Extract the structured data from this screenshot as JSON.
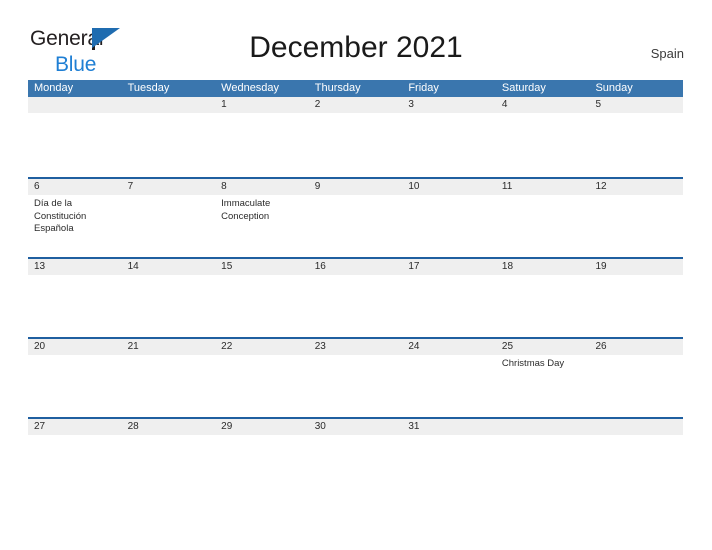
{
  "brand": {
    "name_part1": "General",
    "name_part2": "Blue",
    "logo_icon": "triangle-flag-icon",
    "color_dark": "#231f20",
    "color_blue": "#1f7fd4"
  },
  "header": {
    "title": "December 2021",
    "country": "Spain"
  },
  "theme": {
    "header_bar": "#3a76ae",
    "week_rule": "#1f5fa0",
    "day_band": "#efefef",
    "text": "#2b2b2b"
  },
  "calendar": {
    "weekdays": [
      "Monday",
      "Tuesday",
      "Wednesday",
      "Thursday",
      "Friday",
      "Saturday",
      "Sunday"
    ],
    "weeks": [
      [
        {
          "date": "",
          "events": []
        },
        {
          "date": "",
          "events": []
        },
        {
          "date": "1",
          "events": []
        },
        {
          "date": "2",
          "events": []
        },
        {
          "date": "3",
          "events": []
        },
        {
          "date": "4",
          "events": []
        },
        {
          "date": "5",
          "events": []
        }
      ],
      [
        {
          "date": "6",
          "events": [
            "Día de la Constitución Española"
          ]
        },
        {
          "date": "7",
          "events": []
        },
        {
          "date": "8",
          "events": [
            "Immaculate Conception"
          ]
        },
        {
          "date": "9",
          "events": []
        },
        {
          "date": "10",
          "events": []
        },
        {
          "date": "11",
          "events": []
        },
        {
          "date": "12",
          "events": []
        }
      ],
      [
        {
          "date": "13",
          "events": []
        },
        {
          "date": "14",
          "events": []
        },
        {
          "date": "15",
          "events": []
        },
        {
          "date": "16",
          "events": []
        },
        {
          "date": "17",
          "events": []
        },
        {
          "date": "18",
          "events": []
        },
        {
          "date": "19",
          "events": []
        }
      ],
      [
        {
          "date": "20",
          "events": []
        },
        {
          "date": "21",
          "events": []
        },
        {
          "date": "22",
          "events": []
        },
        {
          "date": "23",
          "events": []
        },
        {
          "date": "24",
          "events": []
        },
        {
          "date": "25",
          "events": [
            "Christmas Day"
          ]
        },
        {
          "date": "26",
          "events": []
        }
      ],
      [
        {
          "date": "27",
          "events": []
        },
        {
          "date": "28",
          "events": []
        },
        {
          "date": "29",
          "events": []
        },
        {
          "date": "30",
          "events": []
        },
        {
          "date": "31",
          "events": []
        },
        {
          "date": "",
          "events": []
        },
        {
          "date": "",
          "events": []
        }
      ]
    ]
  }
}
